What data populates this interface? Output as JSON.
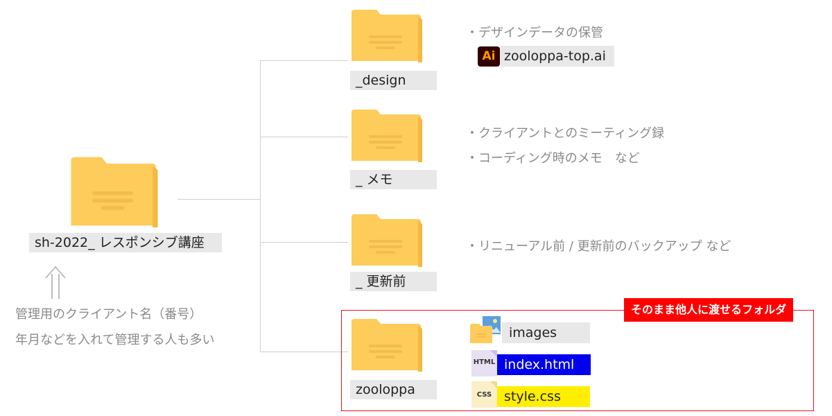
{
  "root": {
    "label": "sh-2022_ レスポンシブ講座",
    "note_line1": "管理用のクライアント名（番号）",
    "note_line2": "年月などを入れて管理する人も多い"
  },
  "folders": [
    {
      "label": "_design",
      "bullets": [
        "・デザインデータの保管"
      ],
      "files": [
        {
          "name": "zooloppa-top.ai",
          "icon": "illustrator-icon",
          "icon_text": "Ai"
        }
      ]
    },
    {
      "label": "_ メモ",
      "bullets": [
        "・クライアントとのミーティング録",
        "・コーディング時のメモ　など"
      ]
    },
    {
      "label": "_ 更新前",
      "bullets": [
        "・リニューアル前 / 更新前のバックアップ など"
      ]
    },
    {
      "label": "zooloppa",
      "files": [
        {
          "name": "images",
          "icon": "image-folder-icon"
        },
        {
          "name": "index.html",
          "icon": "html-file-icon",
          "icon_text": "HTML"
        },
        {
          "name": "style.css",
          "icon": "css-file-icon",
          "icon_text": "CSS"
        }
      ]
    }
  ],
  "callout": "そのまま他人に渡せるフォルダ",
  "colors": {
    "folder": "#fdcc5b",
    "folder_dark": "#f3b941",
    "html_highlight": "#0000ee",
    "css_highlight": "#ffee00",
    "callout": "#ff0000"
  }
}
